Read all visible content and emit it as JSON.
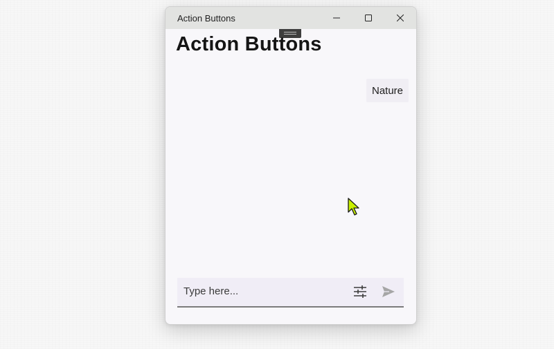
{
  "window": {
    "title": "Action Buttons",
    "controls": {
      "minimize": "minimize-icon",
      "maximize": "maximize-icon",
      "close": "close-icon"
    }
  },
  "main": {
    "heading": "Action Buttons",
    "chips": [
      {
        "label": "Nature"
      }
    ]
  },
  "composer": {
    "placeholder": "Type here...",
    "value": "",
    "filter_icon": "sliders-icon",
    "send_icon": "send-icon"
  },
  "colors": {
    "titlebar": "#e2e3e1",
    "window_bg": "#f8f7fa",
    "input_bg": "#f0edf6",
    "cursor": "#c8f000"
  }
}
